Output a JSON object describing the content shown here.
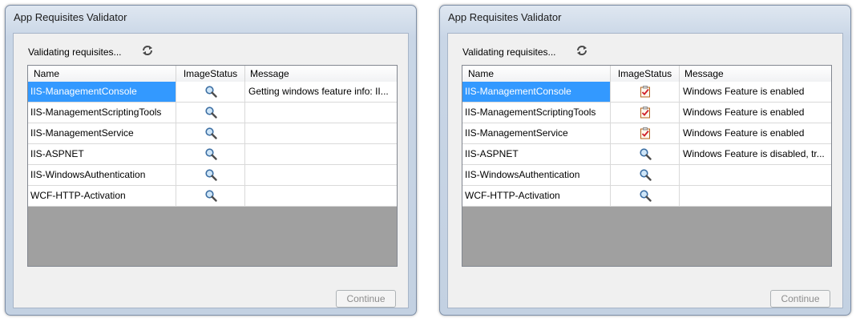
{
  "windows": [
    {
      "title": "App Requisites Validator",
      "status_text": "Validating requisites...",
      "refresh_icon": "refresh-icon",
      "columns": [
        "Name",
        "ImageStatus",
        "Message"
      ],
      "rows": [
        {
          "name": "IIS-ManagementConsole",
          "status_icon": "magnifier-icon",
          "message": "Getting windows feature info: II...",
          "selected": true
        },
        {
          "name": "IIS-ManagementScriptingTools",
          "status_icon": "magnifier-icon",
          "message": ""
        },
        {
          "name": "IIS-ManagementService",
          "status_icon": "magnifier-icon",
          "message": ""
        },
        {
          "name": "IIS-ASPNET",
          "status_icon": "magnifier-icon",
          "message": ""
        },
        {
          "name": "IIS-WindowsAuthentication",
          "status_icon": "magnifier-icon",
          "message": ""
        },
        {
          "name": "WCF-HTTP-Activation",
          "status_icon": "magnifier-icon",
          "message": ""
        }
      ],
      "continue_label": "Continue"
    },
    {
      "title": "App Requisites Validator",
      "status_text": "Validating requisites...",
      "refresh_icon": "refresh-icon",
      "columns": [
        "Name",
        "ImageStatus",
        "Message"
      ],
      "rows": [
        {
          "name": "IIS-ManagementConsole",
          "status_icon": "checklist-icon",
          "message": "Windows Feature is enabled",
          "selected": true
        },
        {
          "name": "IIS-ManagementScriptingTools",
          "status_icon": "checklist-icon",
          "message": "Windows Feature is enabled"
        },
        {
          "name": "IIS-ManagementService",
          "status_icon": "checklist-icon",
          "message": "Windows Feature is enabled"
        },
        {
          "name": "IIS-ASPNET",
          "status_icon": "magnifier-icon",
          "message": "Windows Feature is disabled, tr..."
        },
        {
          "name": "IIS-WindowsAuthentication",
          "status_icon": "magnifier-icon",
          "message": ""
        },
        {
          "name": "WCF-HTTP-Activation",
          "status_icon": "magnifier-icon",
          "message": ""
        }
      ],
      "continue_label": "Continue"
    }
  ],
  "colors": {
    "selection": "#3399ff",
    "grid_empty": "#a0a0a0",
    "title_bar": "#c9d6e6"
  }
}
